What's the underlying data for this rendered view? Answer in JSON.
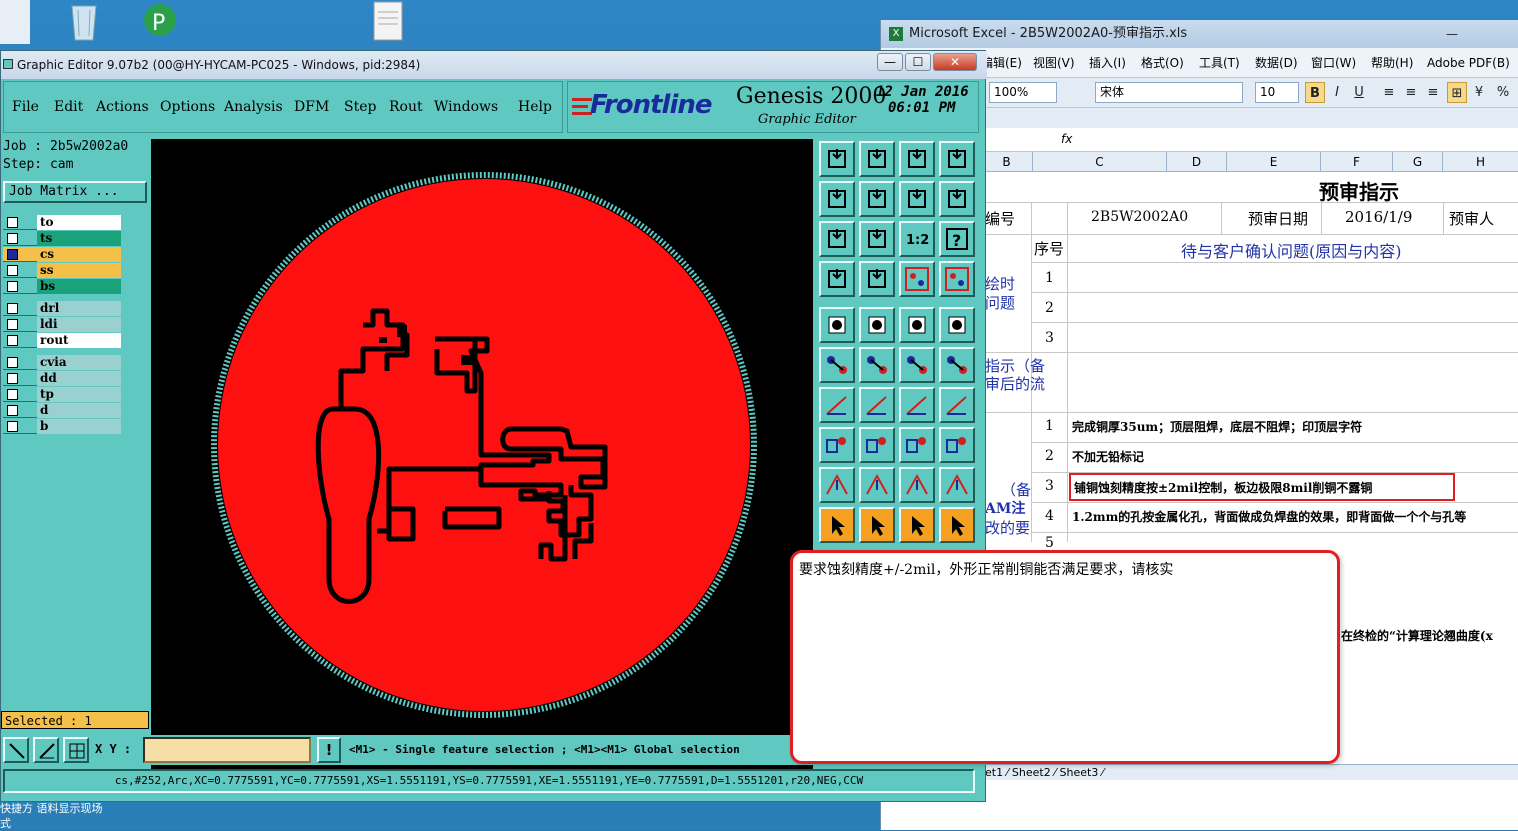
{
  "desktop": {
    "bottom_text_1": "快捷方   语料显示现场",
    "bottom_text_2": "式"
  },
  "excel": {
    "title": "Microsoft Excel - 2B5W2002A0-预审指示.xls",
    "menu": [
      "编辑(E)",
      "视图(V)",
      "插入(I)",
      "格式(O)",
      "工具(T)",
      "数据(D)",
      "窗口(W)",
      "帮助(H)",
      "Adobe PDF(B)"
    ],
    "zoom": "100%",
    "font_name": "宋体",
    "font_size": "10",
    "fx": "fx",
    "columns": [
      "B",
      "C",
      "D",
      "E",
      "F",
      "G",
      "H"
    ],
    "sheet_title": "预审指示",
    "row_no_label": "编号",
    "job_no": "2B5W2002A0",
    "date_label": "预审日期",
    "date_value": "2016/1/9",
    "reviewer_label": "预审人",
    "seq_label": "序号",
    "issues_header": "待与客户确认问题(原因与内容)",
    "left_label_1a": "绘时",
    "left_label_1b": "问题",
    "left_label_2a": "指示（备",
    "left_label_2b": "审后的流",
    "left_label_3a": "（备",
    "left_label_3b": "AM注",
    "left_label_3c": "改的要",
    "nums": [
      "1",
      "2",
      "3",
      "1",
      "2",
      "3",
      "4",
      "5"
    ],
    "item_1": "完成铜厚35um；顶层阻焊，底层不阻焊；印顶层字符",
    "item_2": "不加无铅标记",
    "item_3": "铺铜蚀刻精度按±2mil控制，板边极限8mil削铜不露铜",
    "item_4": "1.2mm的孔按金属化孔，背面做成负焊盘的效果，即背面做一个个与孔等",
    "item_extra": "在终检的“计算理论翘曲度(x",
    "sheet_tabs": "et1 ⁄ Sheet2 ⁄ Sheet3 ⁄"
  },
  "ge": {
    "title": "Graphic Editor 9.07b2 (00@HY-HYCAM-PC025 - Windows, pid:2984)",
    "menu": [
      "File",
      "Edit",
      "Actions",
      "Options",
      "Analysis",
      "DFM",
      "Step",
      "Rout",
      "Windows",
      "Help"
    ],
    "brand": "Frontline",
    "product": "Genesis 2000",
    "subtitle": "Graphic Editor",
    "date": "12 Jan 2016",
    "time": "06:01 PM",
    "job": "Job : 2b5w2002a0",
    "step": "Step: cam",
    "job_matrix": "Job Matrix ...",
    "layers": [
      {
        "name": "to",
        "color": "#ffffff"
      },
      {
        "name": "ts",
        "color": "#1aa27a"
      },
      {
        "name": "cs",
        "color": "#f5c04a"
      },
      {
        "name": "ss",
        "color": "#f5c04a"
      },
      {
        "name": "bs",
        "color": "#1aa27a"
      },
      {
        "name": "drl",
        "color": "#9ad1d0"
      },
      {
        "name": "ldi",
        "color": "#9ad1d0"
      },
      {
        "name": "rout",
        "color": "#ffffff"
      },
      {
        "name": "cvia",
        "color": "#9ad1d0"
      },
      {
        "name": "dd",
        "color": "#9ad1d0"
      },
      {
        "name": "tp",
        "color": "#9ad1d0"
      },
      {
        "name": "d",
        "color": "#9ad1d0"
      },
      {
        "name": "b",
        "color": "#9ad1d0"
      }
    ],
    "selected": "Selected : 1",
    "xy_label": "X Y :",
    "xy_value": "",
    "hint": "<M1> - Single feature selection ; <M1><M1> Global selection",
    "status": "cs,#252,Arc,XC=0.7775591,YC=0.7775591,XS=1.5551191,YS=0.7775591,XE=1.5551191,YE=0.7775591,D=1.5551201,r20,NEG,CCW",
    "colors": {
      "board": "#ff1010",
      "panel": "#5fc9c1",
      "canvas": "#000000"
    }
  },
  "popup": {
    "text": "要求蚀刻精度+/-2mil，外形正常削铜能否满足要求，请核实"
  }
}
